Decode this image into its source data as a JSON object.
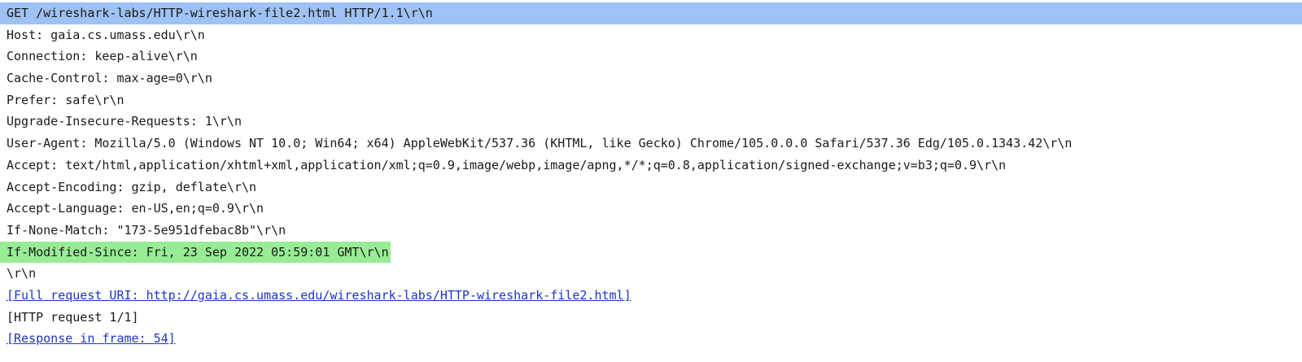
{
  "packet_details": {
    "lines": [
      "GET /wireshark-labs/HTTP-wireshark-file2.html HTTP/1.1\\r\\n",
      "Host: gaia.cs.umass.edu\\r\\n",
      "Connection: keep-alive\\r\\n",
      "Cache-Control: max-age=0\\r\\n",
      "Prefer: safe\\r\\n",
      "Upgrade-Insecure-Requests: 1\\r\\n",
      "User-Agent: Mozilla/5.0 (Windows NT 10.0; Win64; x64) AppleWebKit/537.36 (KHTML, like Gecko) Chrome/105.0.0.0 Safari/537.36 Edg/105.0.1343.42\\r\\n",
      "Accept: text/html,application/xhtml+xml,application/xml;q=0.9,image/webp,image/apng,*/*;q=0.8,application/signed-exchange;v=b3;q=0.9\\r\\n",
      "Accept-Encoding: gzip, deflate\\r\\n",
      "Accept-Language: en-US,en;q=0.9\\r\\n",
      "If-None-Match: \"173-5e951dfebac8b\"\\r\\n",
      "If-Modified-Since: Fri, 23 Sep 2022 05:59:01 GMT\\r\\n",
      "\\r\\n",
      "[Full request URI: http://gaia.cs.umass.edu/wireshark-labs/HTTP-wireshark-file2.html]",
      "[HTTP request 1/1]",
      "[Response in frame: 54]"
    ]
  },
  "colors": {
    "selected_row": "#9ec2f3",
    "highlight_row": "#98ec96",
    "link_text": "#1a35c8"
  }
}
